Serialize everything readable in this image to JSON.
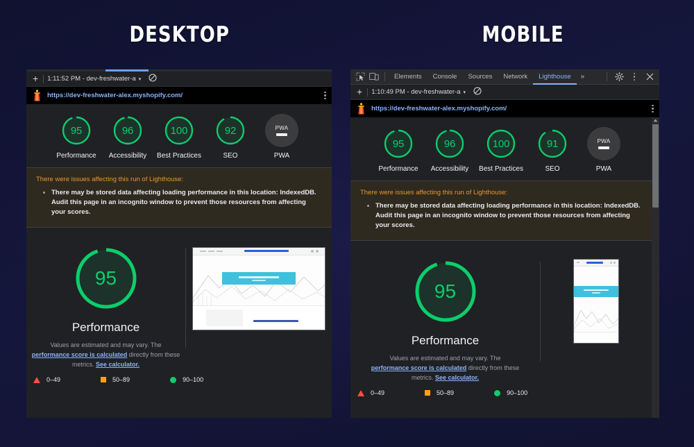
{
  "headings": {
    "left": "DESKTOP",
    "right": "MOBILE"
  },
  "devtools": {
    "icons": {
      "inspect": "inspect-element-icon",
      "device": "device-toolbar-icon",
      "settings": "gear-icon",
      "more": "kebab-menu-icon",
      "close": "close-icon"
    },
    "tabs": [
      {
        "label": "Elements",
        "active": false
      },
      {
        "label": "Console",
        "active": false
      },
      {
        "label": "Sources",
        "active": false
      },
      {
        "label": "Network",
        "active": false
      },
      {
        "label": "Lighthouse",
        "active": true
      }
    ],
    "overflow": "»"
  },
  "desktop": {
    "report_header": {
      "new_run": "+",
      "run_label": "1:11:52 PM - dev-freshwater-a",
      "caret": "▾",
      "clear_icon": "no-entry-icon"
    },
    "url": "https://dev-freshwater-alex.myshopify.com/",
    "scores": [
      {
        "label": "Performance",
        "value": "95",
        "pct": 95
      },
      {
        "label": "Accessibility",
        "value": "96",
        "pct": 96
      },
      {
        "label": "Best Practices",
        "value": "100",
        "pct": 100
      },
      {
        "label": "SEO",
        "value": "92",
        "pct": 92
      },
      {
        "label": "PWA",
        "value": "PWA",
        "pct": null
      }
    ],
    "warning": {
      "title": "There were issues affecting this run of Lighthouse:",
      "items": [
        "There may be stored data affecting loading performance in this location: IndexedDB. Audit this page in an incognito window to prevent those resources from affecting your scores."
      ]
    },
    "performance": {
      "value": "95",
      "pct": 95,
      "title": "Performance",
      "desc_pre": "Values are estimated and may vary. The ",
      "desc_link1": "performance score is calculated",
      "desc_mid": " directly from these metrics. ",
      "desc_link2": "See calculator."
    },
    "legend": [
      {
        "marker": "triangle",
        "text": "0–49"
      },
      {
        "marker": "square",
        "text": "50–89"
      },
      {
        "marker": "circle",
        "text": "90–100"
      }
    ],
    "thumbnail": {
      "banner_text": "Welcome to Freshwater",
      "caption": "Lorem Ipsum Dolor"
    }
  },
  "mobile": {
    "report_header": {
      "new_run": "+",
      "run_label": "1:10:49 PM - dev-freshwater-a",
      "caret": "▾",
      "clear_icon": "no-entry-icon"
    },
    "url": "https://dev-freshwater-alex.myshopify.com/",
    "scores": [
      {
        "label": "Performance",
        "value": "95",
        "pct": 95
      },
      {
        "label": "Accessibility",
        "value": "96",
        "pct": 96
      },
      {
        "label": "Best Practices",
        "value": "100",
        "pct": 100
      },
      {
        "label": "SEO",
        "value": "91",
        "pct": 91
      },
      {
        "label": "PWA",
        "value": "PWA",
        "pct": null
      }
    ],
    "warning": {
      "title": "There were issues affecting this run of Lighthouse:",
      "items": [
        "There may be stored data affecting loading performance in this location: IndexedDB. Audit this page in an incognito window to prevent those resources from affecting your scores."
      ]
    },
    "performance": {
      "value": "95",
      "pct": 95,
      "title": "Performance",
      "desc_pre": "Values are estimated and may vary. The ",
      "desc_link1": "performance score is calculated",
      "desc_mid": " directly from these metrics. ",
      "desc_link2": "See calculator."
    },
    "legend": [
      {
        "marker": "triangle",
        "text": "0–49"
      },
      {
        "marker": "square",
        "text": "50–89"
      },
      {
        "marker": "circle",
        "text": "90–100"
      }
    ],
    "thumbnail": {
      "banner_text": "Welcome to Freshwater",
      "caption": ""
    }
  },
  "colors": {
    "pass": "#0cce6b",
    "average": "#ffa400",
    "fail": "#ff4e42",
    "link": "#8ab4f8",
    "warning_text": "#e9972d",
    "warning_bg": "#2f2a20",
    "panel_bg": "#202124",
    "page_bg": "#14153b"
  }
}
